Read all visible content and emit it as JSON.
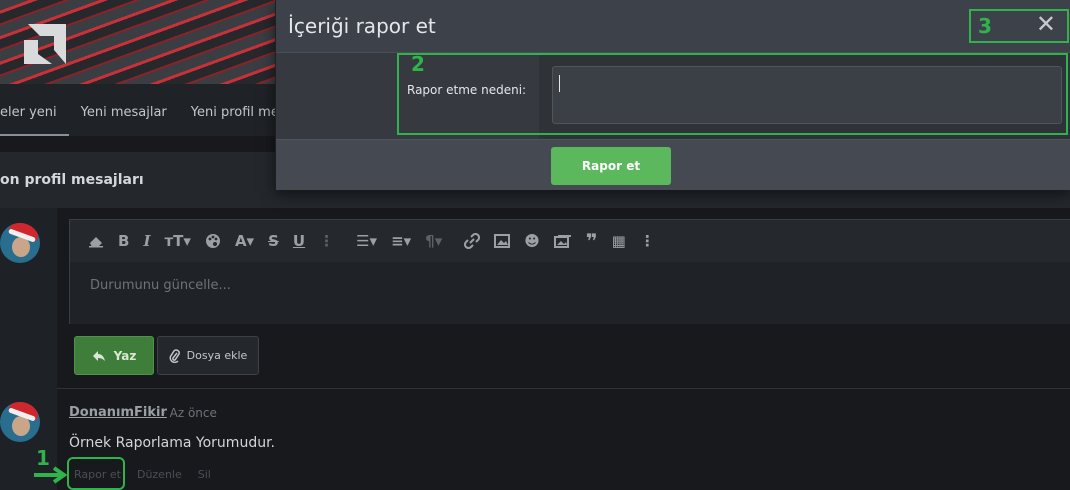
{
  "nav": {
    "tabs": [
      {
        "label": "eler yeni"
      },
      {
        "label": "Yeni mesajlar"
      },
      {
        "label": "Yeni profil mesajları"
      }
    ]
  },
  "section": {
    "title": "on profil mesajları"
  },
  "editor": {
    "toolbar": [
      {
        "icon": "eraser-icon"
      },
      {
        "icon": "bold-icon",
        "glyph": "B"
      },
      {
        "icon": "italic-icon",
        "glyph": "I"
      },
      {
        "icon": "font-size-icon",
        "glyph": "тT▾"
      },
      {
        "icon": "palette-icon"
      },
      {
        "icon": "font-family-icon",
        "glyph": "A▾"
      },
      {
        "icon": "strikethrough-icon",
        "glyph": "S"
      },
      {
        "icon": "underline-icon",
        "glyph": "U"
      },
      {
        "icon": "more-vertical-icon",
        "glyph": "⋮"
      },
      {
        "icon": "list-icon",
        "glyph": "☰▾"
      },
      {
        "icon": "align-icon",
        "glyph": "≡▾"
      },
      {
        "icon": "paragraph-icon",
        "glyph": "¶▾"
      },
      {
        "icon": "link-icon"
      },
      {
        "icon": "image-icon"
      },
      {
        "icon": "smiley-icon",
        "glyph": "☻"
      },
      {
        "icon": "media-icon"
      },
      {
        "icon": "quote-icon",
        "glyph": "❞"
      },
      {
        "icon": "table-icon",
        "glyph": "▦"
      },
      {
        "icon": "more-vertical-icon",
        "glyph": "⋮"
      }
    ],
    "placeholder": "Durumunu güncelle..."
  },
  "buttons": {
    "post_label": "Yaz",
    "attach_label": "Dosya ekle"
  },
  "comment": {
    "author": "DonanımFikir",
    "time": "· Az önce",
    "text": "Örnek Raporlama Yorumudur.",
    "actions": [
      "Rapor et",
      "Düzenle",
      "Sil"
    ]
  },
  "modal": {
    "title": "İçeriği rapor et",
    "field_label": "Rapor etme nedeni:",
    "field_value": "",
    "submit_label": "Rapor et"
  },
  "annotations": {
    "one": "1",
    "two": "2",
    "three": "3"
  },
  "colors": {
    "accent_green": "#5cb85c",
    "annotation_green": "#2fb34a",
    "brand_red": "#c93038"
  }
}
